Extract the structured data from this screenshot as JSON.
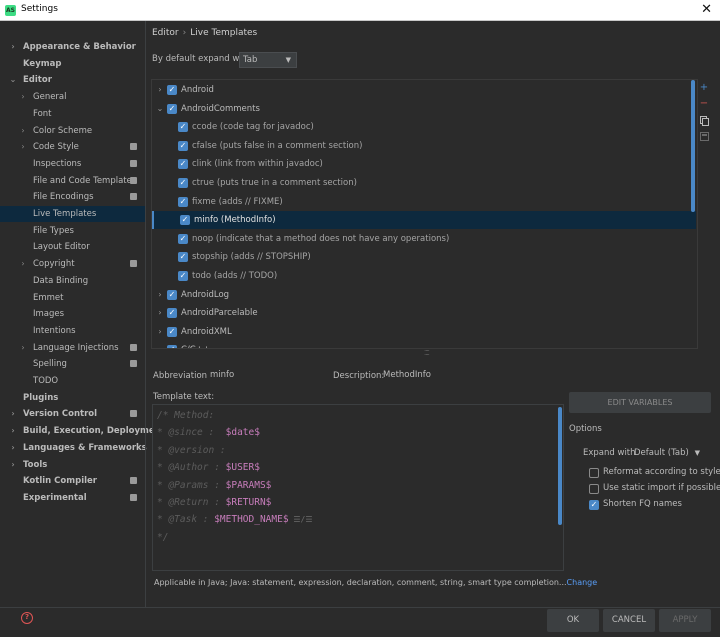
{
  "window": {
    "title": "Settings",
    "app_icon": "AS"
  },
  "sidebar": {
    "items": [
      {
        "label": "Appearance & Behavior",
        "level": 0,
        "arrow": "right",
        "bold": true
      },
      {
        "label": "Keymap",
        "level": 0,
        "bold": true
      },
      {
        "label": "Editor",
        "level": 0,
        "arrow": "down",
        "bold": true
      },
      {
        "label": "General",
        "level": 1,
        "arrow": "right"
      },
      {
        "label": "Font",
        "level": 1
      },
      {
        "label": "Color Scheme",
        "level": 1,
        "arrow": "right"
      },
      {
        "label": "Code Style",
        "level": 1,
        "arrow": "right",
        "badge": true
      },
      {
        "label": "Inspections",
        "level": 1,
        "badge": true
      },
      {
        "label": "File and Code Templates",
        "level": 1,
        "badge": true
      },
      {
        "label": "File Encodings",
        "level": 1,
        "badge": true
      },
      {
        "label": "Live Templates",
        "level": 1,
        "selected": true
      },
      {
        "label": "File Types",
        "level": 1
      },
      {
        "label": "Layout Editor",
        "level": 1
      },
      {
        "label": "Copyright",
        "level": 1,
        "arrow": "right",
        "badge": true
      },
      {
        "label": "Data Binding",
        "level": 1
      },
      {
        "label": "Emmet",
        "level": 1
      },
      {
        "label": "Images",
        "level": 1
      },
      {
        "label": "Intentions",
        "level": 1
      },
      {
        "label": "Language Injections",
        "level": 1,
        "arrow": "right",
        "badge": true
      },
      {
        "label": "Spelling",
        "level": 1,
        "badge": true
      },
      {
        "label": "TODO",
        "level": 1
      },
      {
        "label": "Plugins",
        "level": 0,
        "bold": true
      },
      {
        "label": "Version Control",
        "level": 0,
        "arrow": "right",
        "bold": true,
        "badge": true
      },
      {
        "label": "Build, Execution, Deployment",
        "level": 0,
        "arrow": "right",
        "bold": true
      },
      {
        "label": "Languages & Frameworks",
        "level": 0,
        "arrow": "right",
        "bold": true
      },
      {
        "label": "Tools",
        "level": 0,
        "arrow": "right",
        "bold": true
      },
      {
        "label": "Kotlin Compiler",
        "level": 0,
        "bold": true,
        "badge": true
      },
      {
        "label": "Experimental",
        "level": 0,
        "bold": true,
        "badge": true
      }
    ]
  },
  "breadcrumb": {
    "parent": "Editor",
    "separator": "›",
    "current": "Live Templates"
  },
  "expand_default": {
    "label": "By default expand with",
    "value": "Tab"
  },
  "templates": [
    {
      "label": "Android",
      "group": true,
      "expanded": false
    },
    {
      "label": "AndroidComments",
      "group": true,
      "expanded": true
    },
    {
      "label": "ccode (code tag for javadoc)"
    },
    {
      "label": "cfalse (puts false in a comment section)"
    },
    {
      "label": "clink (link from within javadoc)"
    },
    {
      "label": "ctrue (puts true in a comment section)"
    },
    {
      "label": "fixme (adds // FIXME)"
    },
    {
      "label": "minfo (MethodInfo)",
      "selected": true
    },
    {
      "label": "noop (indicate that a method does not have any operations)"
    },
    {
      "label": "stopship (adds // STOPSHIP)"
    },
    {
      "label": "todo (adds // TODO)"
    },
    {
      "label": "AndroidLog",
      "group": true,
      "expanded": false
    },
    {
      "label": "AndroidParcelable",
      "group": true,
      "expanded": false
    },
    {
      "label": "AndroidXML",
      "group": true,
      "expanded": false
    },
    {
      "label": "C/C++",
      "group": true,
      "expanded": false
    }
  ],
  "toolbar": {
    "add_icon": "plus-icon",
    "remove_icon": "minus-icon",
    "copy_icon": "copy-icon",
    "restore_icon": "restore-icon"
  },
  "abbreviation": {
    "label": "Abbreviation:",
    "value": "minfo"
  },
  "description": {
    "label": "Description:",
    "value": "MethodInfo"
  },
  "template_text": {
    "label": "Template text:",
    "lines": [
      {
        "comment": "/* Method:",
        "var": ""
      },
      {
        "comment": "* @since :  ",
        "var": "$date$"
      },
      {
        "comment": "* @version :",
        "var": ""
      },
      {
        "comment": "* @Author : ",
        "var": "$USER$"
      },
      {
        "comment": "* @Params : ",
        "var": "$PARAMS$"
      },
      {
        "comment": "* @Return : ",
        "var": "$RETURN$"
      },
      {
        "comment": "* @Task : ",
        "var": "$METHOD_NAME$",
        "glyph": "☰/☰"
      },
      {
        "comment": "*/",
        "var": ""
      }
    ]
  },
  "applicable": {
    "text": "Applicable in Java; Java: statement, expression, declaration, comment, string, smart type completion...",
    "link": "Change"
  },
  "options": {
    "edit_variables": "EDIT VARIABLES",
    "title": "Options",
    "expand_label": "Expand with",
    "expand_value": "Default (Tab)",
    "checks": [
      {
        "label": "Reformat according to style",
        "checked": false
      },
      {
        "label": "Use static import if possible",
        "checked": false
      },
      {
        "label": "Shorten FQ names",
        "checked": true
      }
    ]
  },
  "buttons": {
    "ok": "OK",
    "cancel": "CANCEL",
    "apply": "APPLY"
  },
  "colors": {
    "accent": "#4a88c7",
    "selection": "#0d293e",
    "template_var": "#c77dbb",
    "link": "#589df6"
  }
}
